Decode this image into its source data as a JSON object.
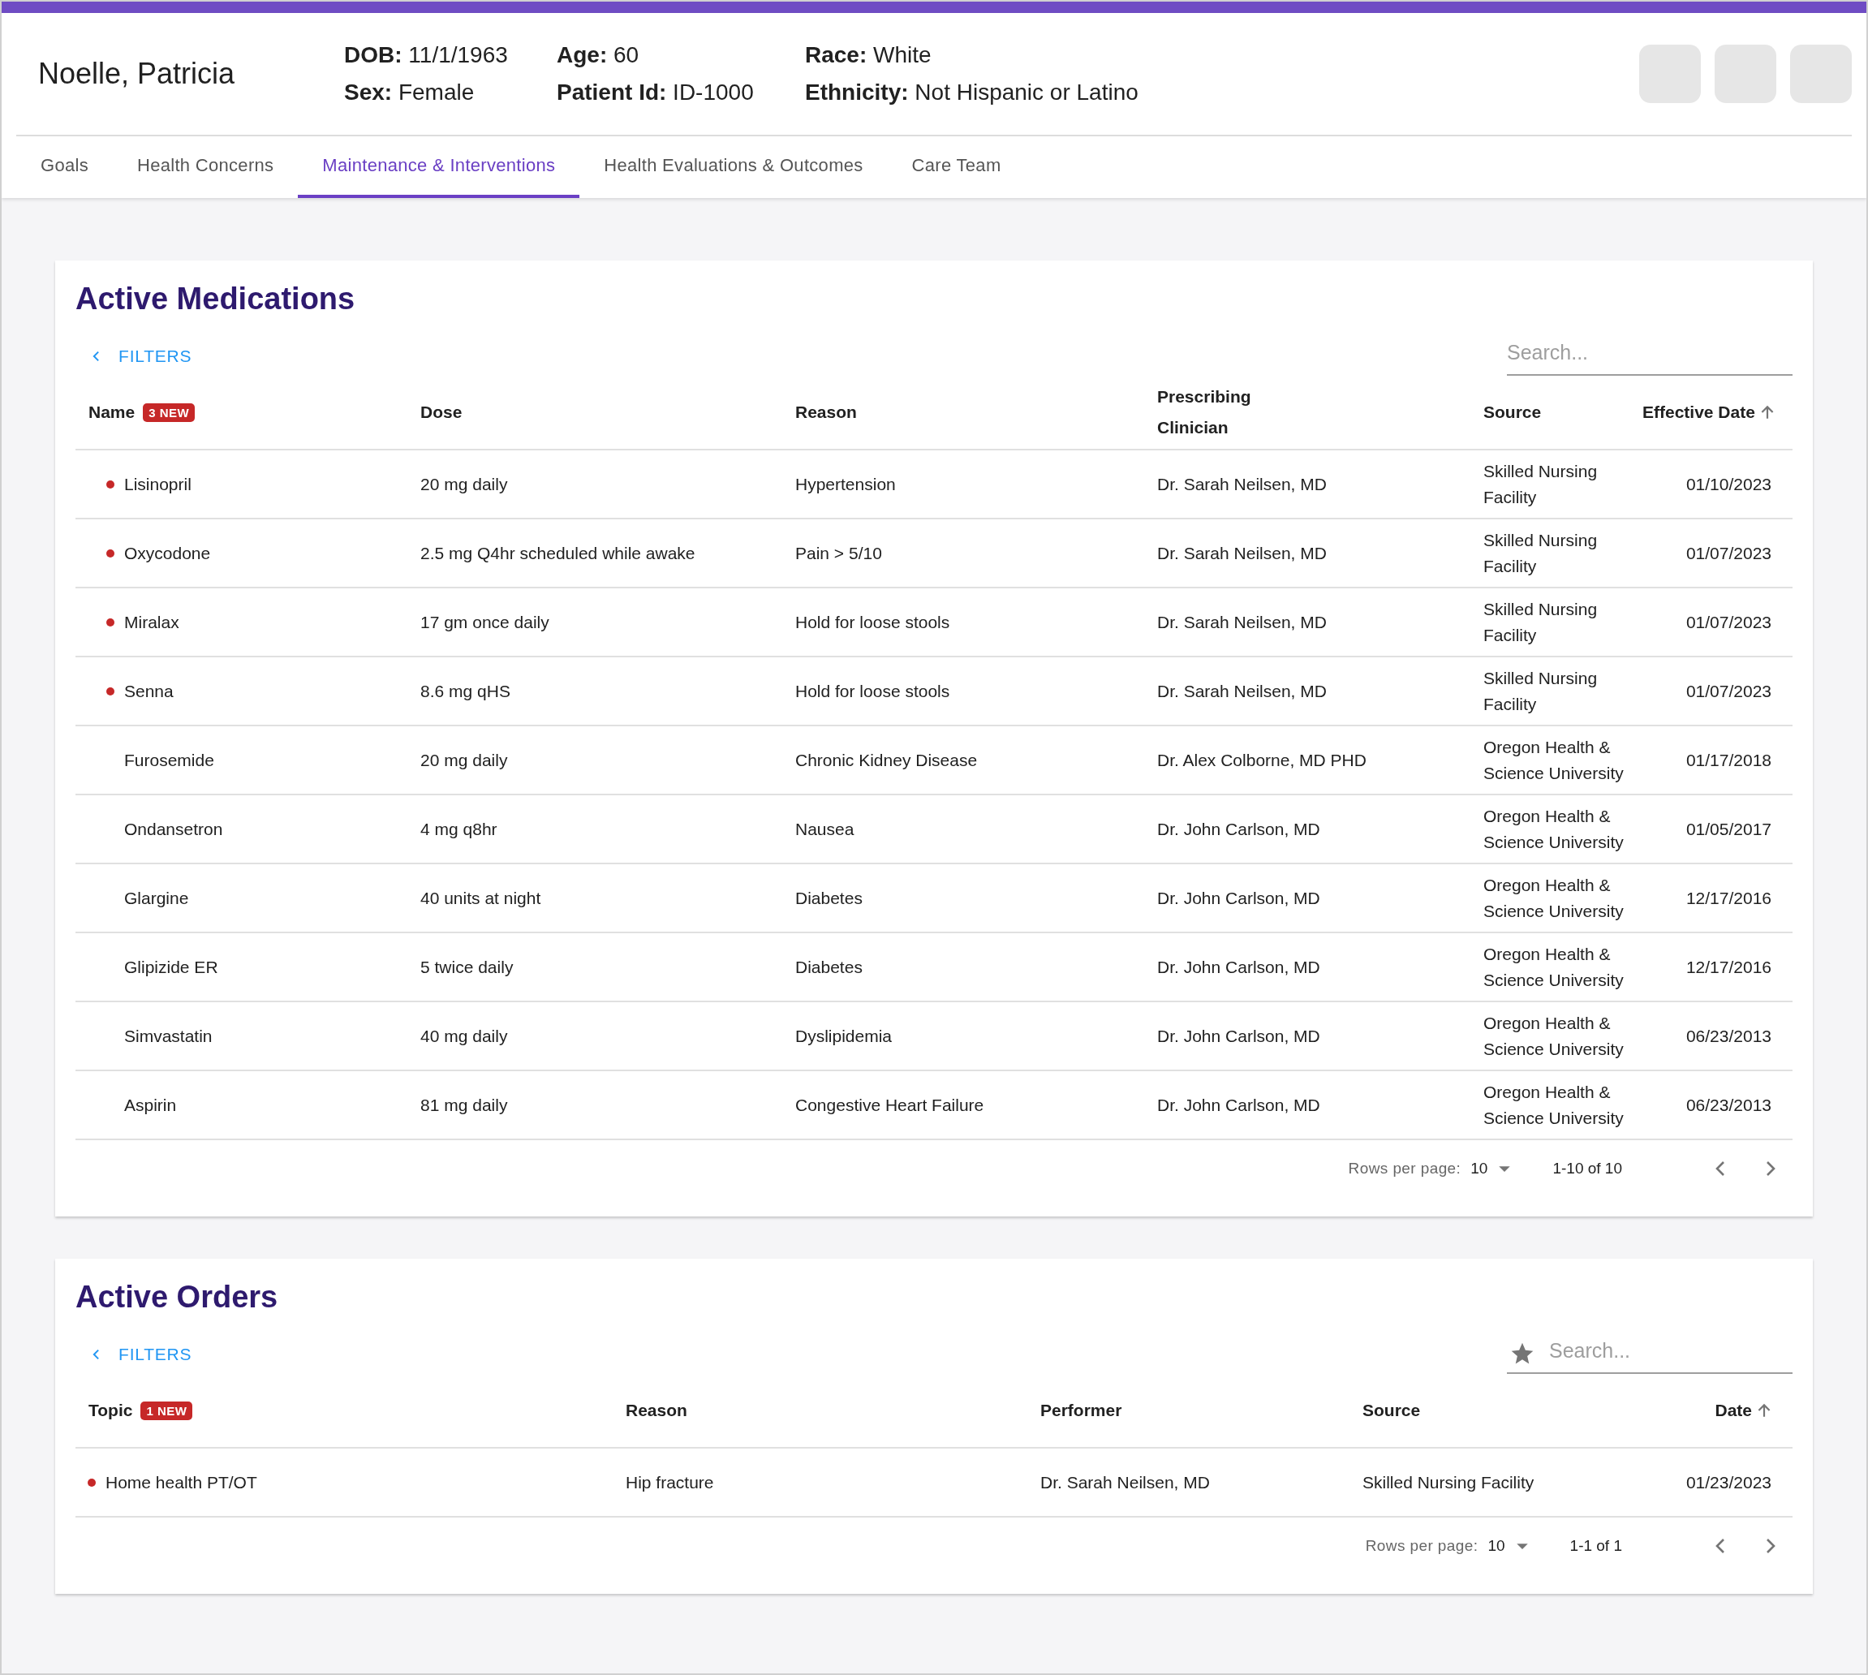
{
  "patient": {
    "name": "Noelle, Patricia",
    "fields": [
      {
        "items": [
          {
            "label": "DOB:",
            "value": "11/1/1963"
          },
          {
            "label": "Sex:",
            "value": "Female"
          }
        ]
      },
      {
        "items": [
          {
            "label": "Age:",
            "value": "60"
          },
          {
            "label": "Patient Id:",
            "value": "ID-1000"
          }
        ]
      },
      {
        "items": [
          {
            "label": "Race:",
            "value": "White"
          },
          {
            "label": "Ethnicity:",
            "value": "Not Hispanic or Latino"
          }
        ]
      }
    ]
  },
  "tabs": [
    {
      "label": "Goals",
      "selected": false
    },
    {
      "label": "Health Concerns",
      "selected": false
    },
    {
      "label": "Maintenance & Interventions",
      "selected": true
    },
    {
      "label": "Health Evaluations & Outcomes",
      "selected": false
    },
    {
      "label": "Care Team",
      "selected": false
    }
  ],
  "medications": {
    "title": "Active Medications",
    "filters": "FILTERS",
    "search": {
      "placeholder": "Search..."
    },
    "columns": [
      {
        "label": "Name",
        "badge": "3 NEW"
      },
      {
        "label": "Dose"
      },
      {
        "label": "Reason"
      },
      {
        "label": "Prescribing Clinician"
      },
      {
        "label": "Source"
      },
      {
        "label": "Effective Date",
        "sorted": true
      }
    ],
    "rows": [
      {
        "new": true,
        "cells": [
          "Lisinopril",
          "20 mg daily",
          "Hypertension",
          "Dr. Sarah Neilsen, MD",
          "Skilled Nursing Facility",
          "01/10/2023"
        ]
      },
      {
        "new": true,
        "cells": [
          "Oxycodone",
          "2.5 mg Q4hr scheduled while awake",
          "Pain > 5/10",
          "Dr. Sarah Neilsen, MD",
          "Skilled Nursing Facility",
          "01/07/2023"
        ]
      },
      {
        "new": true,
        "cells": [
          "Miralax",
          "17 gm once daily",
          "Hold for loose stools",
          "Dr. Sarah Neilsen, MD",
          "Skilled Nursing Facility",
          "01/07/2023"
        ]
      },
      {
        "new": true,
        "cells": [
          "Senna",
          "8.6 mg qHS",
          "Hold for loose stools",
          "Dr. Sarah Neilsen, MD",
          "Skilled Nursing Facility",
          "01/07/2023"
        ]
      },
      {
        "new": false,
        "cells": [
          "Furosemide",
          "20 mg daily",
          "Chronic Kidney Disease",
          "Dr. Alex Colborne, MD PHD",
          "Oregon Health & Science University",
          "01/17/2018"
        ]
      },
      {
        "new": false,
        "cells": [
          "Ondansetron",
          "4 mg q8hr",
          "Nausea",
          "Dr. John Carlson, MD",
          "Oregon Health & Science University",
          "01/05/2017"
        ]
      },
      {
        "new": false,
        "cells": [
          "Glargine",
          "40 units at night",
          "Diabetes",
          "Dr. John Carlson, MD",
          "Oregon Health & Science University",
          "12/17/2016"
        ]
      },
      {
        "new": false,
        "cells": [
          "Glipizide ER",
          "5 twice daily",
          "Diabetes",
          "Dr. John Carlson, MD",
          "Oregon Health & Science University",
          "12/17/2016"
        ]
      },
      {
        "new": false,
        "cells": [
          "Simvastatin",
          "40 mg daily",
          "Dyslipidemia",
          "Dr. John Carlson, MD",
          "Oregon Health & Science University",
          "06/23/2013"
        ]
      },
      {
        "new": false,
        "cells": [
          "Aspirin",
          "81 mg daily",
          "Congestive Heart Failure",
          "Dr. John Carlson, MD",
          "Oregon Health & Science University",
          "06/23/2013"
        ]
      }
    ],
    "pagination": {
      "rows_label": "Rows per page:",
      "rows_value": "10",
      "range": "1-10 of 10"
    }
  },
  "orders": {
    "title": "Active Orders",
    "filters": "FILTERS",
    "search": {
      "kind": "starred",
      "placeholder": "Search..."
    },
    "columns": [
      {
        "label": "Topic",
        "badge": "1 NEW"
      },
      {
        "label": "Reason"
      },
      {
        "label": "Performer"
      },
      {
        "label": "Source"
      },
      {
        "label": "Date",
        "sorted": true
      }
    ],
    "rows": [
      {
        "new": true,
        "cells": [
          "Home health PT/OT",
          "Hip fracture",
          "Dr. Sarah Neilsen, MD",
          "Skilled Nursing Facility",
          "01/23/2023"
        ]
      }
    ],
    "pagination": {
      "rows_label": "Rows per page:",
      "rows_value": "10",
      "range": "1-1 of 1"
    }
  }
}
